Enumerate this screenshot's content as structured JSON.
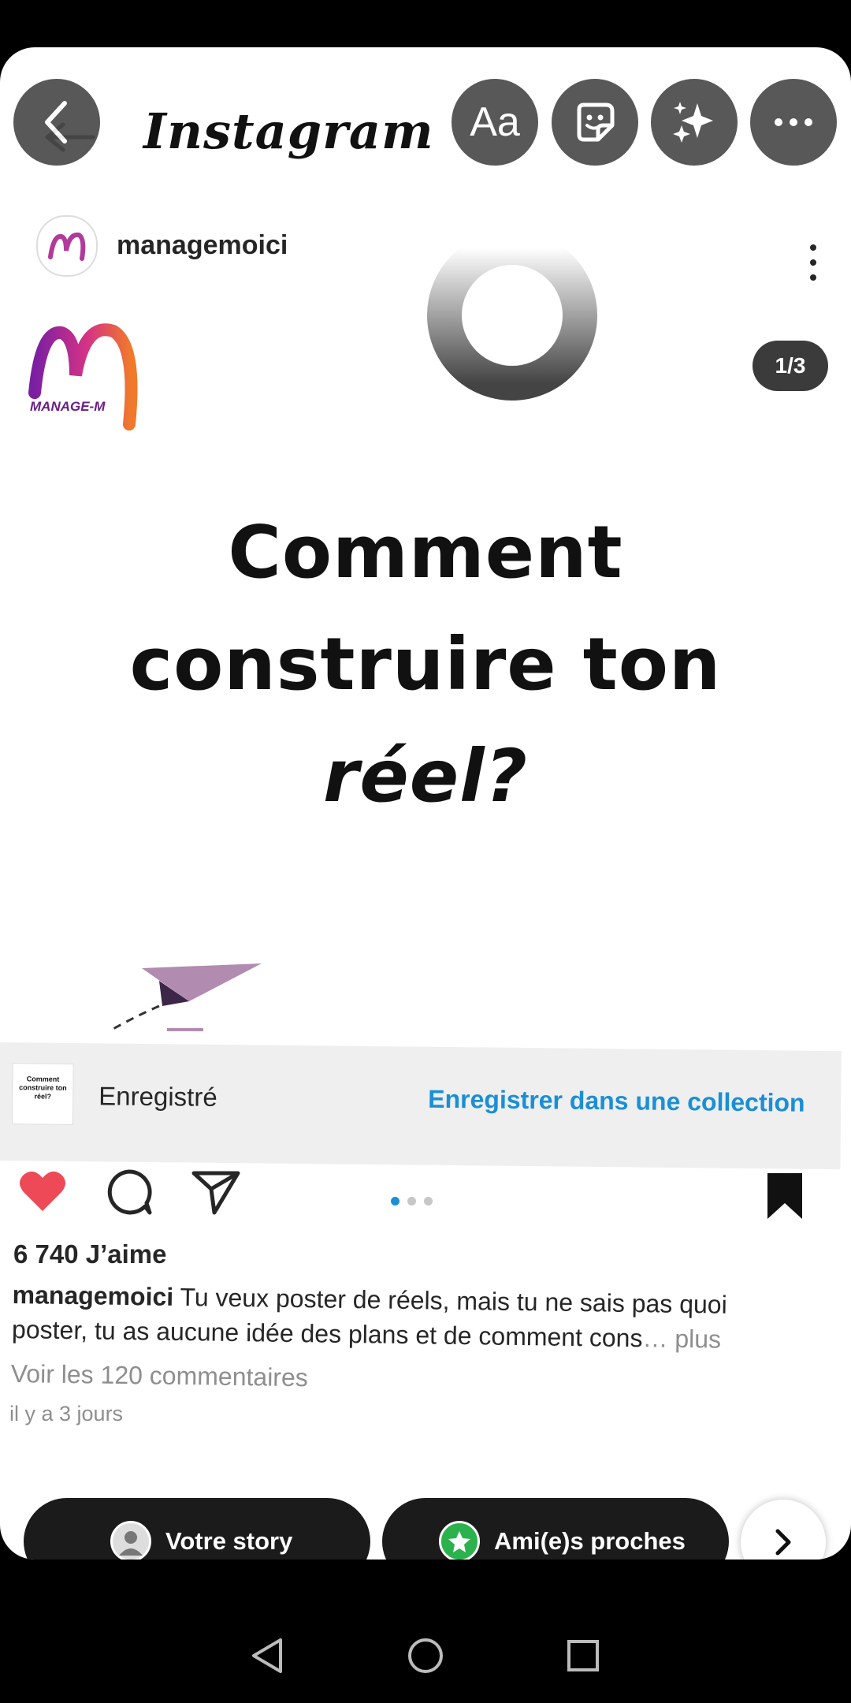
{
  "header": {
    "app_logo": "Instagram",
    "back_icon": "back-arrow-icon",
    "tools": [
      {
        "name": "text-tool",
        "label": "Aa"
      },
      {
        "name": "sticker-tool",
        "icon": "sticker-icon"
      },
      {
        "name": "effects-tool",
        "icon": "sparkles-icon"
      },
      {
        "name": "more-tool",
        "icon": "more-horizontal-icon"
      }
    ]
  },
  "post": {
    "username": "managemoici",
    "brand_logo_text": "MANAGE-M",
    "slide_counter": "1/3",
    "headline": [
      "Comment",
      "construire ton",
      "réel?"
    ]
  },
  "saved_bar": {
    "thumb_text": "Comment construire ton réel?",
    "label": "Enregistré",
    "collection_link": "Enregistrer dans une collection"
  },
  "actions": {
    "liked": true,
    "carousel_dots": 3,
    "active_dot": 0,
    "like_color": "#ed4956",
    "link_color": "#1a8fd6"
  },
  "details": {
    "likes": "6 740 J’aime",
    "caption_user": "managemoici",
    "caption_text": "Tu veux poster de réels, mais tu ne sais pas quoi poster, tu as aucune idée des plans et de comment cons",
    "caption_ellipsis": "…",
    "caption_more": "plus",
    "comments_link": "Voir les 120 commentaires",
    "timestamp": "il y a 3 jours"
  },
  "share": {
    "story_label": "Votre story",
    "close_friends_label": "Ami(e)s proches",
    "close_friends_color": "#2bb24c"
  },
  "nav": [
    "back-triangle-icon",
    "home-circle-icon",
    "recents-square-icon"
  ]
}
